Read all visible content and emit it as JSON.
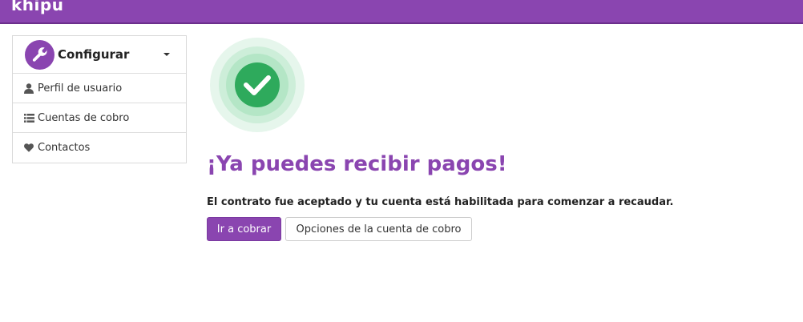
{
  "header": {
    "logo_text": "khipu",
    "brand_color": "#8a45b0"
  },
  "sidebar": {
    "title": "Configurar",
    "title_icon": "wrench-icon",
    "items": [
      {
        "label": "Perfil de usuario",
        "icon": "user-icon"
      },
      {
        "label": "Cuentas de cobro",
        "icon": "list-icon"
      },
      {
        "label": "Contactos",
        "icon": "heart-icon"
      }
    ]
  },
  "main": {
    "status_icon": "check-circle-icon",
    "heading": "¡Ya puedes recibir pagos!",
    "message": "El contrato fue aceptado y tu cuenta está habilitada para comenzar a recaudar.",
    "primary_button": "Ir a cobrar",
    "secondary_button": "Opciones de la cuenta de cobro",
    "success_color": "#2eaa5c"
  }
}
